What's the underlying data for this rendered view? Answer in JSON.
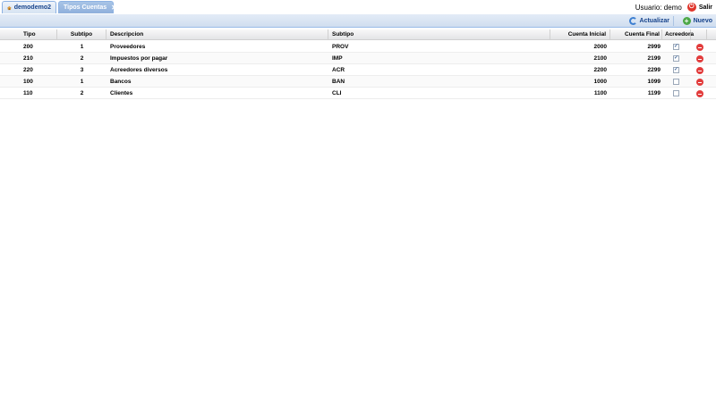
{
  "tabs": [
    {
      "label": "demodemo2",
      "icon": "home-icon"
    },
    {
      "label": "Tipos Cuentas",
      "icon": "close-icon"
    }
  ],
  "user": {
    "label": "Usuario: demo",
    "exit_label": "Salir"
  },
  "toolbar": {
    "refresh_label": "Actualizar",
    "new_label": "Nuevo"
  },
  "grid": {
    "columns": [
      "Tipo",
      "Subtipo",
      "Descripcion",
      "Subtipo",
      "Cuenta Inicial",
      "Cuenta Final",
      "Acreedora"
    ],
    "rows": [
      {
        "tipo": "200",
        "subtipo": "1",
        "descripcion": "Proveedores",
        "subtipo_code": "PROV",
        "inicial": "2000",
        "final": "2999",
        "acreedora": true
      },
      {
        "tipo": "210",
        "subtipo": "2",
        "descripcion": "Impuestos por pagar",
        "subtipo_code": "IMP",
        "inicial": "2100",
        "final": "2199",
        "acreedora": true
      },
      {
        "tipo": "220",
        "subtipo": "3",
        "descripcion": "Acreedores diversos",
        "subtipo_code": "ACR",
        "inicial": "2200",
        "final": "2299",
        "acreedora": true
      },
      {
        "tipo": "100",
        "subtipo": "1",
        "descripcion": "Bancos",
        "subtipo_code": "BAN",
        "inicial": "1000",
        "final": "1099",
        "acreedora": false
      },
      {
        "tipo": "110",
        "subtipo": "2",
        "descripcion": "Clientes",
        "subtipo_code": "CLI",
        "inicial": "1100",
        "final": "1199",
        "acreedora": false
      }
    ]
  },
  "colors": {
    "accent": "#15428b",
    "delete": "#e23c3c",
    "exit": "#e0352b"
  }
}
